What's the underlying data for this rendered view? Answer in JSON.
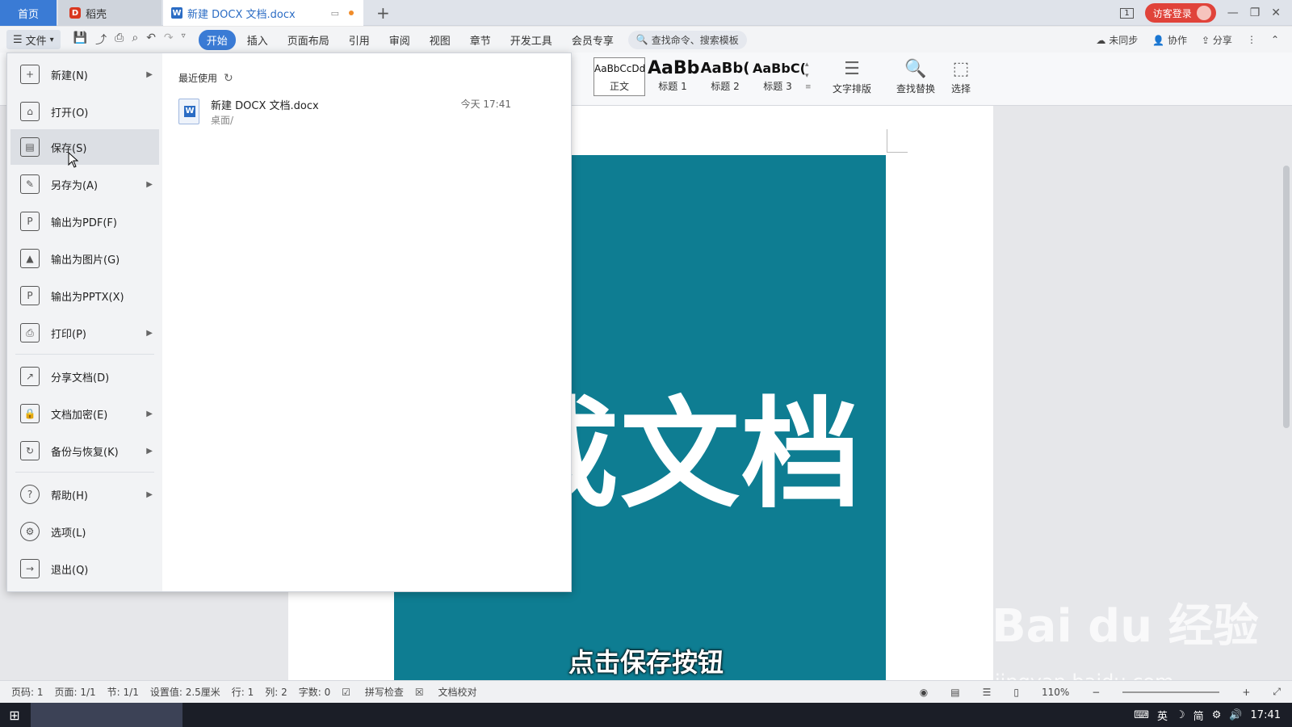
{
  "tabs": {
    "home": "首页",
    "daoke": "稻壳",
    "document": "新建 DOCX 文档.docx",
    "add": "+"
  },
  "titlebar": {
    "login": "访客登录",
    "minimize": "—",
    "restore": "❐",
    "close": "✕",
    "layout_badge": "1"
  },
  "menubar": {
    "file": "文件",
    "tabs": [
      "开始",
      "插入",
      "页面布局",
      "引用",
      "审阅",
      "视图",
      "章节",
      "开发工具",
      "会员专享"
    ],
    "active_tab": "开始",
    "search_placeholder": "查找命令、搜索模板",
    "sync": "未同步",
    "collab": "协作",
    "share": "分享"
  },
  "ribbon": {
    "styles": [
      {
        "sample": "AaBbCcDd",
        "label": "正文"
      },
      {
        "sample": "AaBb",
        "label": "标题 1"
      },
      {
        "sample": "AaBb(",
        "label": "标题 2"
      },
      {
        "sample": "AaBbC(",
        "label": "标题 3"
      }
    ],
    "text_layout": "文字排版",
    "find_replace": "查找替换",
    "select": "选择"
  },
  "file_menu": {
    "items": [
      {
        "label": "新建(N)",
        "icon": "new-doc-icon",
        "arrow": true
      },
      {
        "label": "打开(O)",
        "icon": "folder-icon",
        "arrow": false
      },
      {
        "label": "保存(S)",
        "icon": "save-icon",
        "arrow": false
      },
      {
        "label": "另存为(A)",
        "icon": "save-as-icon",
        "arrow": true
      },
      {
        "label": "输出为PDF(F)",
        "icon": "pdf-icon",
        "arrow": false
      },
      {
        "label": "输出为图片(G)",
        "icon": "image-icon",
        "arrow": false
      },
      {
        "label": "输出为PPTX(X)",
        "icon": "pptx-icon",
        "arrow": false
      },
      {
        "label": "打印(P)",
        "icon": "print-icon",
        "arrow": true
      },
      {
        "label": "分享文档(D)",
        "icon": "share-icon",
        "arrow": false
      },
      {
        "label": "文档加密(E)",
        "icon": "lock-icon",
        "arrow": true
      },
      {
        "label": "备份与恢复(K)",
        "icon": "backup-icon",
        "arrow": true
      },
      {
        "label": "帮助(H)",
        "icon": "help-icon",
        "arrow": true
      },
      {
        "label": "选项(L)",
        "icon": "gear-icon",
        "arrow": false
      },
      {
        "label": "退出(Q)",
        "icon": "exit-icon",
        "arrow": false
      }
    ],
    "hovered": "保存(S)",
    "recent_title": "最近使用",
    "recent_files": [
      {
        "name": "新建 DOCX 文档.docx",
        "path": "桌面/",
        "time": "今天 17:41"
      }
    ]
  },
  "document": {
    "image_text": "么转成文档",
    "subtitle": "点击保存按钮"
  },
  "watermark": {
    "main": "Bai du 经验",
    "sub": "jingyan.baidu.com"
  },
  "statusbar": {
    "page_code": "页码: 1",
    "page": "页面: 1/1",
    "section": "节: 1/1",
    "setting": "设置值: 2.5厘米",
    "row": "行: 1",
    "col": "列: 2",
    "words": "字数: 0",
    "spell": "拼写检查",
    "proof": "文档校对",
    "zoom": "110%"
  },
  "taskbar": {
    "time": "17:41",
    "ime": "英",
    "simplified": "简"
  },
  "colors": {
    "accent": "#3a7bd5",
    "image_bg": "#0e7d92",
    "login": "#e0433a"
  }
}
